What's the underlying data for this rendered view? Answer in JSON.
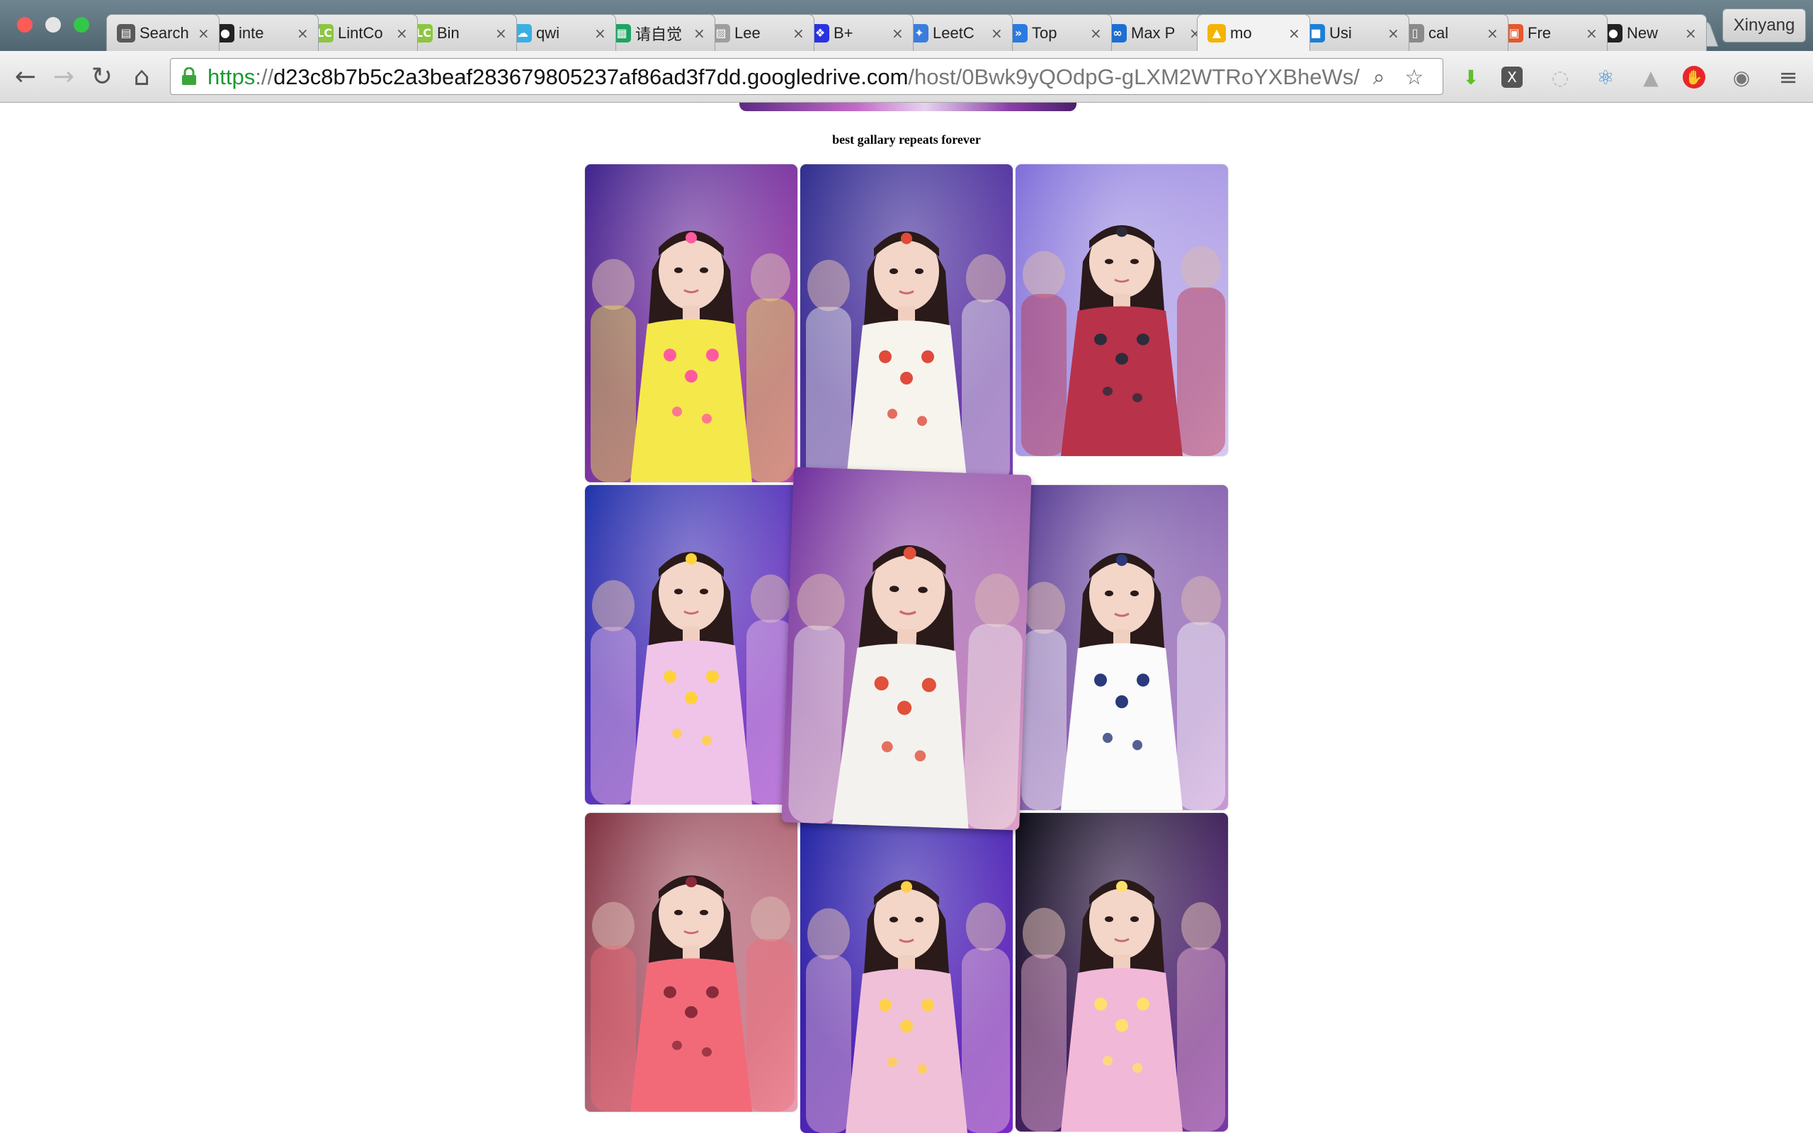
{
  "browser": {
    "tabs": [
      {
        "label": "Search",
        "icon": "book-icon",
        "color": "#5a5a5a",
        "glyph": "▤"
      },
      {
        "label": "inte",
        "icon": "github-icon",
        "color": "#222222",
        "glyph": "●"
      },
      {
        "label": "LintCo",
        "icon": "lintcode-icon",
        "color": "#8cc63f",
        "glyph": "LC"
      },
      {
        "label": "Bin",
        "icon": "lintcode-icon",
        "color": "#8cc63f",
        "glyph": "LC"
      },
      {
        "label": "qwi",
        "icon": "cloud-icon",
        "color": "#3ab0e2",
        "glyph": "☁"
      },
      {
        "label": "请自觉",
        "icon": "sheets-icon",
        "color": "#1fa463",
        "glyph": "▦"
      },
      {
        "label": "Lee",
        "icon": "image-icon",
        "color": "#9e9e9e",
        "glyph": "▨"
      },
      {
        "label": "B+",
        "icon": "baidu-paw-icon",
        "color": "#2932e1",
        "glyph": "❖"
      },
      {
        "label": "LeetC",
        "icon": "puzzle-icon",
        "color": "#3b7ddd",
        "glyph": "✦"
      },
      {
        "label": "Top",
        "icon": "bolt-icon",
        "color": "#2a7ae2",
        "glyph": "»"
      },
      {
        "label": "Max P",
        "icon": "brain-icon",
        "color": "#1c6fd1",
        "glyph": "∞"
      },
      {
        "label": "mo",
        "icon": "drive-icon",
        "color": "#f4b400",
        "glyph": "▲"
      },
      {
        "label": "Usi",
        "icon": "chat-icon",
        "color": "#1b7fd6",
        "glyph": "■"
      },
      {
        "label": "cal",
        "icon": "document-icon",
        "color": "#8a8a8a",
        "glyph": "▯"
      },
      {
        "label": "Fre",
        "icon": "grid-icon",
        "color": "#e6582b",
        "glyph": "▣"
      },
      {
        "label": "New",
        "icon": "github-icon",
        "color": "#222222",
        "glyph": "●"
      }
    ],
    "active_tab_index": 11,
    "profile_name": "Xinyang",
    "url": {
      "scheme": "https",
      "separator": "://",
      "host": "d23c8b7b5c2a3beaf283679805237af86ad3f7dd.googledrive.com",
      "path": "/host/0Bwk9yQOdpG-gLXM2WTRoYXBheWs/"
    }
  },
  "page": {
    "gallery_title": "best gallary repeats forever",
    "photos": [
      {
        "name": "photo-1",
        "bg": [
          "#3a1f8a",
          "#c04ab8"
        ],
        "outfit": "#f5e84a",
        "accent": "#ff5aa0"
      },
      {
        "name": "photo-2",
        "bg": [
          "#2a2a8c",
          "#7b3fb5"
        ],
        "outfit": "#f7f4ee",
        "accent": "#e04a3a"
      },
      {
        "name": "photo-3",
        "bg": [
          "#7b6ad8",
          "#d8c8f2"
        ],
        "outfit": "#b8324a",
        "accent": "#2c2c3a"
      },
      {
        "name": "photo-4",
        "bg": [
          "#1a2fa8",
          "#9a3fd0"
        ],
        "outfit": "#f0c4e8",
        "accent": "#ffd23a"
      },
      {
        "name": "photo-5",
        "bg": [
          "#6a2a9a",
          "#e0a0c8"
        ],
        "outfit": "#f4f2ee",
        "accent": "#e0503a"
      },
      {
        "name": "photo-6",
        "bg": [
          "#4a2f8a",
          "#c89ad8"
        ],
        "outfit": "#fbfbfb",
        "accent": "#2a3a7a"
      },
      {
        "name": "photo-7",
        "bg": [
          "#7a2a3a",
          "#e8a0b0"
        ],
        "outfit": "#f26a78",
        "accent": "#8a2a3a"
      },
      {
        "name": "photo-8",
        "bg": [
          "#1a1fa0",
          "#7a2ac8"
        ],
        "outfit": "#f0c0d8",
        "accent": "#ffd04a"
      },
      {
        "name": "photo-9",
        "bg": [
          "#05060e",
          "#7a3aa8"
        ],
        "outfit": "#f2b8d8",
        "accent": "#ffe06a"
      }
    ]
  }
}
